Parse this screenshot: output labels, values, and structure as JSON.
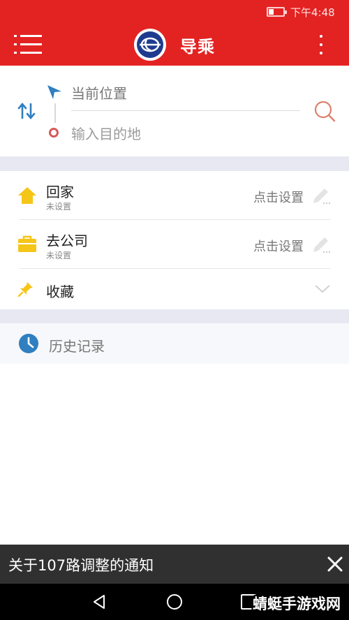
{
  "status_bar": {
    "time": "下午4:48",
    "battery_level": 0.25,
    "battery_color": "#ffffff"
  },
  "header": {
    "title": "导乘",
    "background": "#e32322",
    "menu_icon": "hamburger-icon",
    "more_icon": "more-vertical-icon",
    "logo_icon": "bus-logo-icon"
  },
  "route": {
    "origin_label": "当前位置",
    "destination_placeholder": "输入目的地",
    "swap_icon": "swap-vertical-icon",
    "search_icon": "search-icon",
    "accent": "#2f7fc1",
    "destination_color": "#d45a5a"
  },
  "favorites": {
    "home": {
      "label": "回家",
      "status": "未设置",
      "action": "点击设置",
      "icon": "home-icon",
      "color": "#f5c518"
    },
    "work": {
      "label": "去公司",
      "status": "未设置",
      "action": "点击设置",
      "icon": "briefcase-icon",
      "color": "#f5c518"
    },
    "collection": {
      "label": "收藏",
      "icon": "pin-icon",
      "expand_icon": "chevron-down-icon"
    }
  },
  "history": {
    "label": "历史记录",
    "icon": "clock-icon",
    "color": "#2f7fc1"
  },
  "notice": {
    "text": "关于107路调整的通知",
    "close_icon": "close-icon"
  },
  "system_nav": {
    "back_icon": "back-icon",
    "home_icon": "home-circle-icon",
    "recent_icon": "recent-apps-icon"
  },
  "watermark": {
    "text": "蜻蜓手游戏网"
  }
}
